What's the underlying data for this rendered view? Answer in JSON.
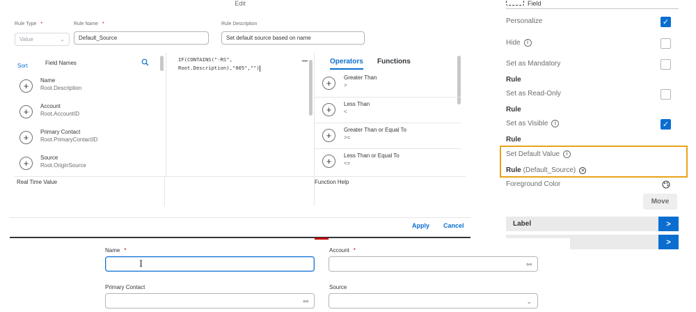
{
  "dialog": {
    "title": "Edit",
    "rule_type": {
      "label": "Rule Type",
      "value": "Value"
    },
    "rule_name": {
      "label": "Rule Name",
      "value": "Default_Source"
    },
    "rule_description": {
      "label": "Rule Description",
      "value": "Set default source based on name"
    },
    "required_marker": "*",
    "field_list": {
      "sort_label": "Sort",
      "header": "Field Names",
      "items": [
        {
          "name": "Name",
          "path": "Root.Description"
        },
        {
          "name": "Account",
          "path": "Root.AccountID"
        },
        {
          "name": "Primary Contact",
          "path": "Root.PrimaryContactID"
        },
        {
          "name": "Source",
          "path": "Root.OriginSource"
        }
      ]
    },
    "code": {
      "line1": "IF(CONTAINS(\"-RS\",",
      "line2": "Root.Description),\"005\",\"\")"
    },
    "operators": {
      "tabs": [
        "Operators",
        "Functions"
      ],
      "items": [
        {
          "name": "Greater Than",
          "symbol": ">"
        },
        {
          "name": "Less Than",
          "symbol": "<"
        },
        {
          "name": "Greater Than or Equal To",
          "symbol": ">="
        },
        {
          "name": "Less Than or Equal To",
          "symbol": "<="
        }
      ]
    },
    "real_time_value_label": "Real Time Value",
    "function_help_label": "Function Help",
    "apply_label": "Apply",
    "cancel_label": "Cancel"
  },
  "side_panel": {
    "field_label": "Field",
    "personalize": "Personalize",
    "hide": "Hide",
    "set_mandatory": "Set as Mandatory",
    "rule": "Rule",
    "set_read_only": "Set as Read-Only",
    "set_visible": "Set as Visible",
    "set_default_value": "Set Default Value",
    "default_rule_name": "(Default_Source)",
    "foreground_color": "Foreground Color",
    "move_label": "Move",
    "label_row": "Label",
    "nav_arrow": ">"
  },
  "form": {
    "name_label": "Name",
    "account_label": "Account",
    "primary_contact_label": "Primary Contact",
    "source_label": "Source"
  },
  "colors": {
    "accent": "#0a6ed1",
    "highlight": "#e8a317",
    "required": "#bb0000"
  }
}
